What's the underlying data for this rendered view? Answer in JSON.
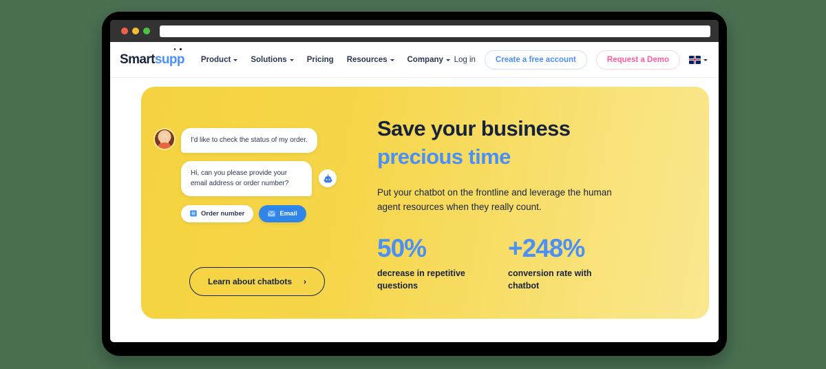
{
  "browser": {
    "traffic_lights": [
      "close",
      "minimize",
      "maximize"
    ],
    "address_bar_value": "",
    "address_bar_placeholder": ""
  },
  "header": {
    "logo": {
      "part1": "Smart",
      "part2": "supp"
    },
    "nav": [
      {
        "label": "Product",
        "has_dropdown": true
      },
      {
        "label": "Solutions",
        "has_dropdown": true
      },
      {
        "label": "Pricing",
        "has_dropdown": false
      },
      {
        "label": "Resources",
        "has_dropdown": true
      },
      {
        "label": "Company",
        "has_dropdown": true
      }
    ],
    "login_label": "Log in",
    "signup_label": "Create a free account",
    "demo_label": "Request a Demo",
    "language": "en"
  },
  "hero": {
    "headline_line1": "Save your business",
    "headline_line2": "precious time",
    "subheadline": "Put your chatbot on the frontline and leverage the human agent resources when they really count.",
    "cta_label": "Learn about chatbots",
    "cta_chevron": "›",
    "stats": [
      {
        "value": "50%",
        "label": "decrease in repetitive questions"
      },
      {
        "value": "+248%",
        "label": "conversion rate with chatbot"
      }
    ]
  },
  "chat": {
    "message_user": "I'd like to check the status of my order.",
    "message_bot": "Hi, can you please provide your email address or order number?",
    "chips": [
      {
        "label": "Order number",
        "icon": "id-card-icon"
      },
      {
        "label": "Email",
        "icon": "envelope-icon"
      }
    ]
  },
  "colors": {
    "page_background": "#4a7052",
    "frame": "#000000",
    "chrome": "#333333",
    "hero_yellow_start": "#f5d33f",
    "hero_yellow_end": "#fae890",
    "accent_blue": "#4a90f7",
    "accent_pink": "#ff5ca0",
    "navy": "#17223b",
    "chip_email_blue": "#2f86e8"
  }
}
